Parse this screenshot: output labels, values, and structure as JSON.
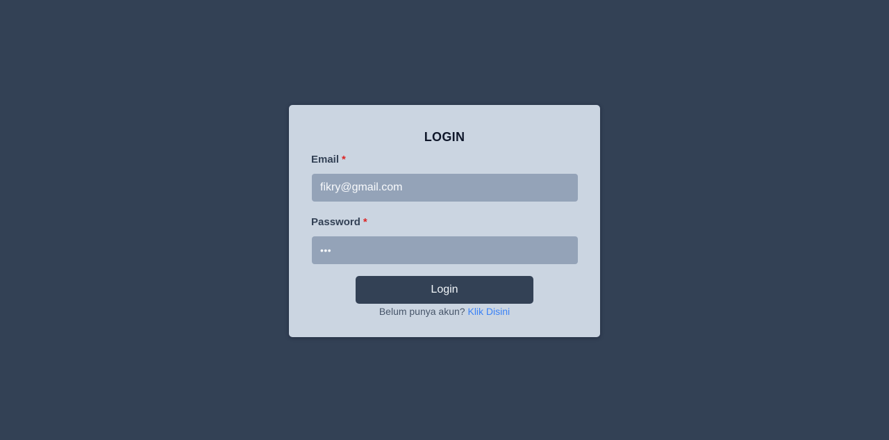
{
  "form": {
    "title": "LOGIN",
    "email": {
      "label": "Email",
      "required_mark": "*",
      "value": "fikry@gmail.com"
    },
    "password": {
      "label": "Password",
      "required_mark": "*",
      "value": "abc"
    },
    "login_button": "Login",
    "register_prompt": "Belum punya akun?",
    "register_link": "Klik Disini"
  },
  "colors": {
    "background": "#334155",
    "card": "#cbd5e1",
    "input": "#94a3b8",
    "button": "#334155",
    "link": "#3b82f6",
    "required": "#dc2626"
  }
}
